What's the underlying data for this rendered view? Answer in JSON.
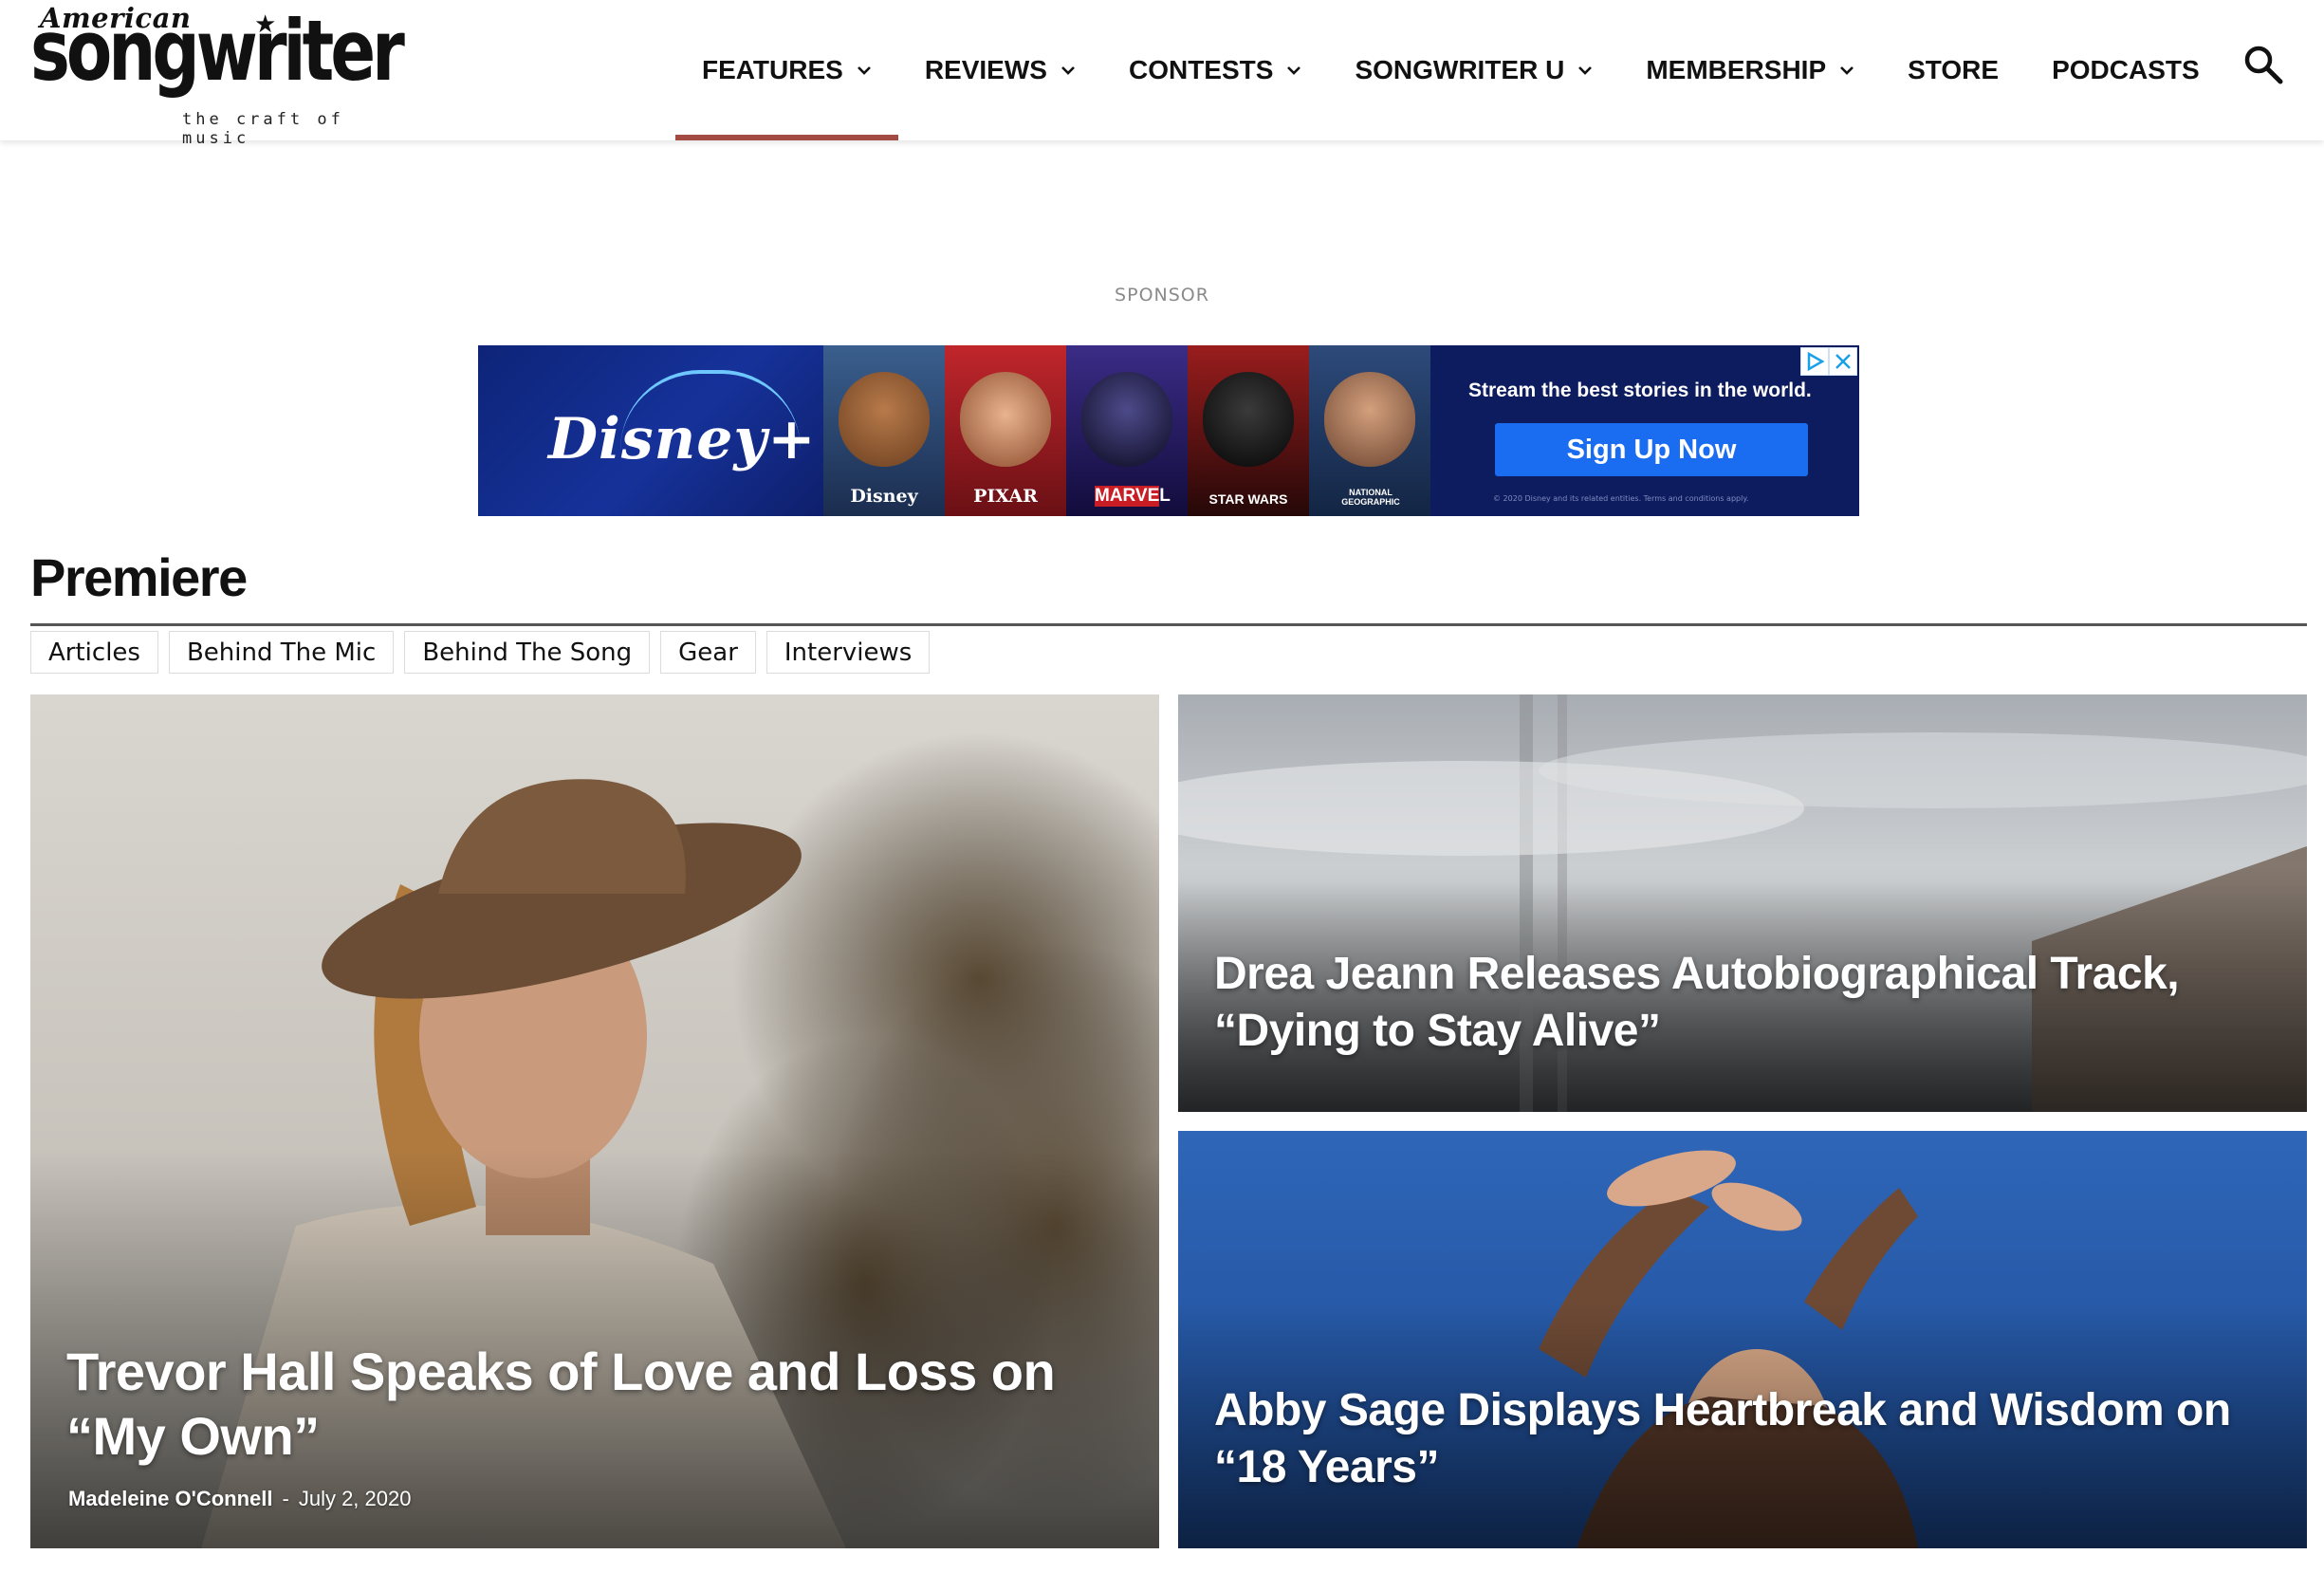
{
  "logo": {
    "top": "American",
    "main": "songwriter",
    "tagline": "the craft of music"
  },
  "nav": {
    "items": [
      {
        "label": "FEATURES",
        "dropdown": true,
        "active": true
      },
      {
        "label": "REVIEWS",
        "dropdown": true
      },
      {
        "label": "CONTESTS",
        "dropdown": true
      },
      {
        "label": "SONGWRITER U",
        "dropdown": true
      },
      {
        "label": "MEMBERSHIP",
        "dropdown": true
      },
      {
        "label": "STORE",
        "dropdown": false
      },
      {
        "label": "PODCASTS",
        "dropdown": false
      }
    ],
    "search_icon": "search-icon",
    "active_color": "#a34a43"
  },
  "sponsor": {
    "label": "SPONSOR",
    "ad": {
      "brand": "Disney+",
      "tiles": [
        "Disney",
        "PIXAR",
        "MARVEL",
        "STAR WARS",
        "NATIONAL GEOGRAPHIC"
      ],
      "tagline": "Stream the best stories in the world.",
      "cta": "Sign Up Now",
      "fine_print": "© 2020 Disney and its related entities. Terms and conditions apply.",
      "cta_color": "#1a6cf0",
      "bg_color": "#0d1c5e"
    }
  },
  "section": {
    "title": "Premiere",
    "tabs": [
      "Articles",
      "Behind The Mic",
      "Behind The Song",
      "Gear",
      "Interviews"
    ]
  },
  "features": {
    "main": {
      "title": "Trevor Hall Speaks of Love and Loss on “My Own”",
      "author": "Madeleine O'Connell",
      "separator": "-",
      "date": "July 2, 2020"
    },
    "side": [
      {
        "title": "Drea Jeann Releases Autobiographical Track, “Dying to Stay Alive”"
      },
      {
        "title": "Abby Sage Displays Heartbreak and Wisdom on “18 Years”"
      }
    ]
  }
}
